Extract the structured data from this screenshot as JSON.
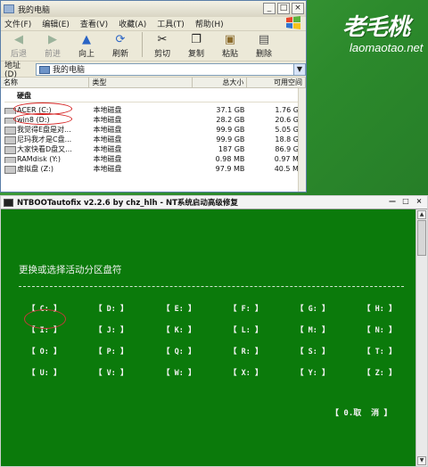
{
  "brand": {
    "logo_text": "老毛桃",
    "url": "laomaotao.net"
  },
  "explorer": {
    "title": "我的电脑",
    "menu": [
      "文件(F)",
      "编辑(E)",
      "查看(V)",
      "收藏(A)",
      "工具(T)",
      "帮助(H)"
    ],
    "toolbar": [
      {
        "label": "后退",
        "icon": "back-arrow-icon",
        "enabled": false
      },
      {
        "label": "前进",
        "icon": "forward-arrow-icon",
        "enabled": false
      },
      {
        "label": "向上",
        "icon": "up-arrow-icon",
        "enabled": true
      },
      {
        "label": "刷新",
        "icon": "refresh-icon",
        "enabled": true
      },
      {
        "label": "剪切",
        "icon": "scissors-icon",
        "enabled": true
      },
      {
        "label": "复制",
        "icon": "copy-icon",
        "enabled": true
      },
      {
        "label": "粘贴",
        "icon": "paste-icon",
        "enabled": true
      },
      {
        "label": "删除",
        "icon": "delete-icon",
        "enabled": true
      }
    ],
    "address_label": "地址(D)",
    "address_value": "我的电脑",
    "columns": {
      "name": "名称",
      "type": "类型",
      "total": "总大小",
      "free": "可用空间"
    },
    "group": "硬盘",
    "drives": [
      {
        "name": "ACER (C:)",
        "type": "本地磁盘",
        "total": "37.1 GB",
        "free": "1.76 GE"
      },
      {
        "name": "win8 (D:)",
        "type": "本地磁盘",
        "total": "28.2 GB",
        "free": "20.6 GE"
      },
      {
        "name": "我觉得E盘是对...",
        "type": "本地磁盘",
        "total": "99.9 GB",
        "free": "5.05 GE"
      },
      {
        "name": "尼玛我才是C盘...",
        "type": "本地磁盘",
        "total": "99.9 GB",
        "free": "18.8 GE"
      },
      {
        "name": "大家快看D盘又...",
        "type": "本地磁盘",
        "total": "187 GB",
        "free": "86.9 GE"
      },
      {
        "name": "RAMdisk (Y:)",
        "type": "本地磁盘",
        "total": "0.98 MB",
        "free": "0.97 ME"
      },
      {
        "name": "虚拟盘 (Z:)",
        "type": "本地磁盘",
        "total": "97.9 MB",
        "free": "40.5 ME"
      }
    ]
  },
  "console": {
    "title": "NTBOOTautofix v2.2.6 by chz_hlh - NT系统启动高级修复",
    "prompt": "更换或选择活动分区盘符",
    "drives": [
      [
        "【 C: 】",
        "【 D: 】",
        "【 E: 】",
        "【 F: 】",
        "【 G: 】",
        "【 H: 】"
      ],
      [
        "【 I: 】",
        "【 J: 】",
        "【 K: 】",
        "【 L: 】",
        "【 M: 】",
        "【 N: 】"
      ],
      [
        "【 O: 】",
        "【 P: 】",
        "【 Q: 】",
        "【 R: 】",
        "【 S: 】",
        "【 T: 】"
      ],
      [
        "【 U: 】",
        "【 V: 】",
        "【 W: 】",
        "【 X: 】",
        "【 Y: 】",
        "【 Z: 】"
      ]
    ],
    "cancel": "【 0.取  消 】"
  },
  "colors": {
    "console_bg": "#0b7a0b",
    "desktop": "#2f8a2f",
    "highlight_red": "#d42020"
  }
}
